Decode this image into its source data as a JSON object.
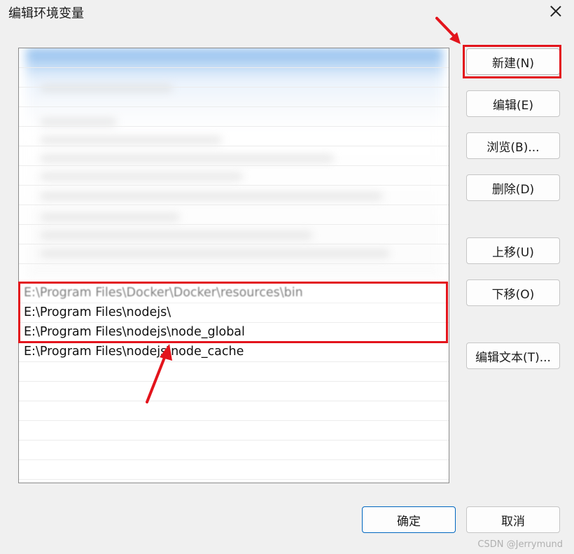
{
  "window": {
    "title": "编辑环境变量",
    "close_label": "×"
  },
  "path_list": {
    "blurred_rows": [
      "",
      "",
      "",
      "",
      "",
      "",
      "",
      "",
      "",
      "",
      "",
      ""
    ],
    "visible_partial_row": "E:\\Program Files\\Docker\\Docker\\resources\\bin",
    "highlighted_rows": [
      "E:\\Program Files\\nodejs\\",
      "E:\\Program Files\\nodejs\\node_global",
      "E:\\Program Files\\nodejs\\node_cache"
    ],
    "empty_row_count": 7
  },
  "buttons": {
    "new": "新建(N)",
    "edit": "编辑(E)",
    "browse": "浏览(B)...",
    "delete": "删除(D)",
    "move_up": "上移(U)",
    "move_down": "下移(O)",
    "edit_text": "编辑文本(T)...",
    "ok": "确定",
    "cancel": "取消"
  },
  "annotation": {
    "highlight_color": "#e3141c"
  },
  "watermark": "CSDN @Jerrymund"
}
